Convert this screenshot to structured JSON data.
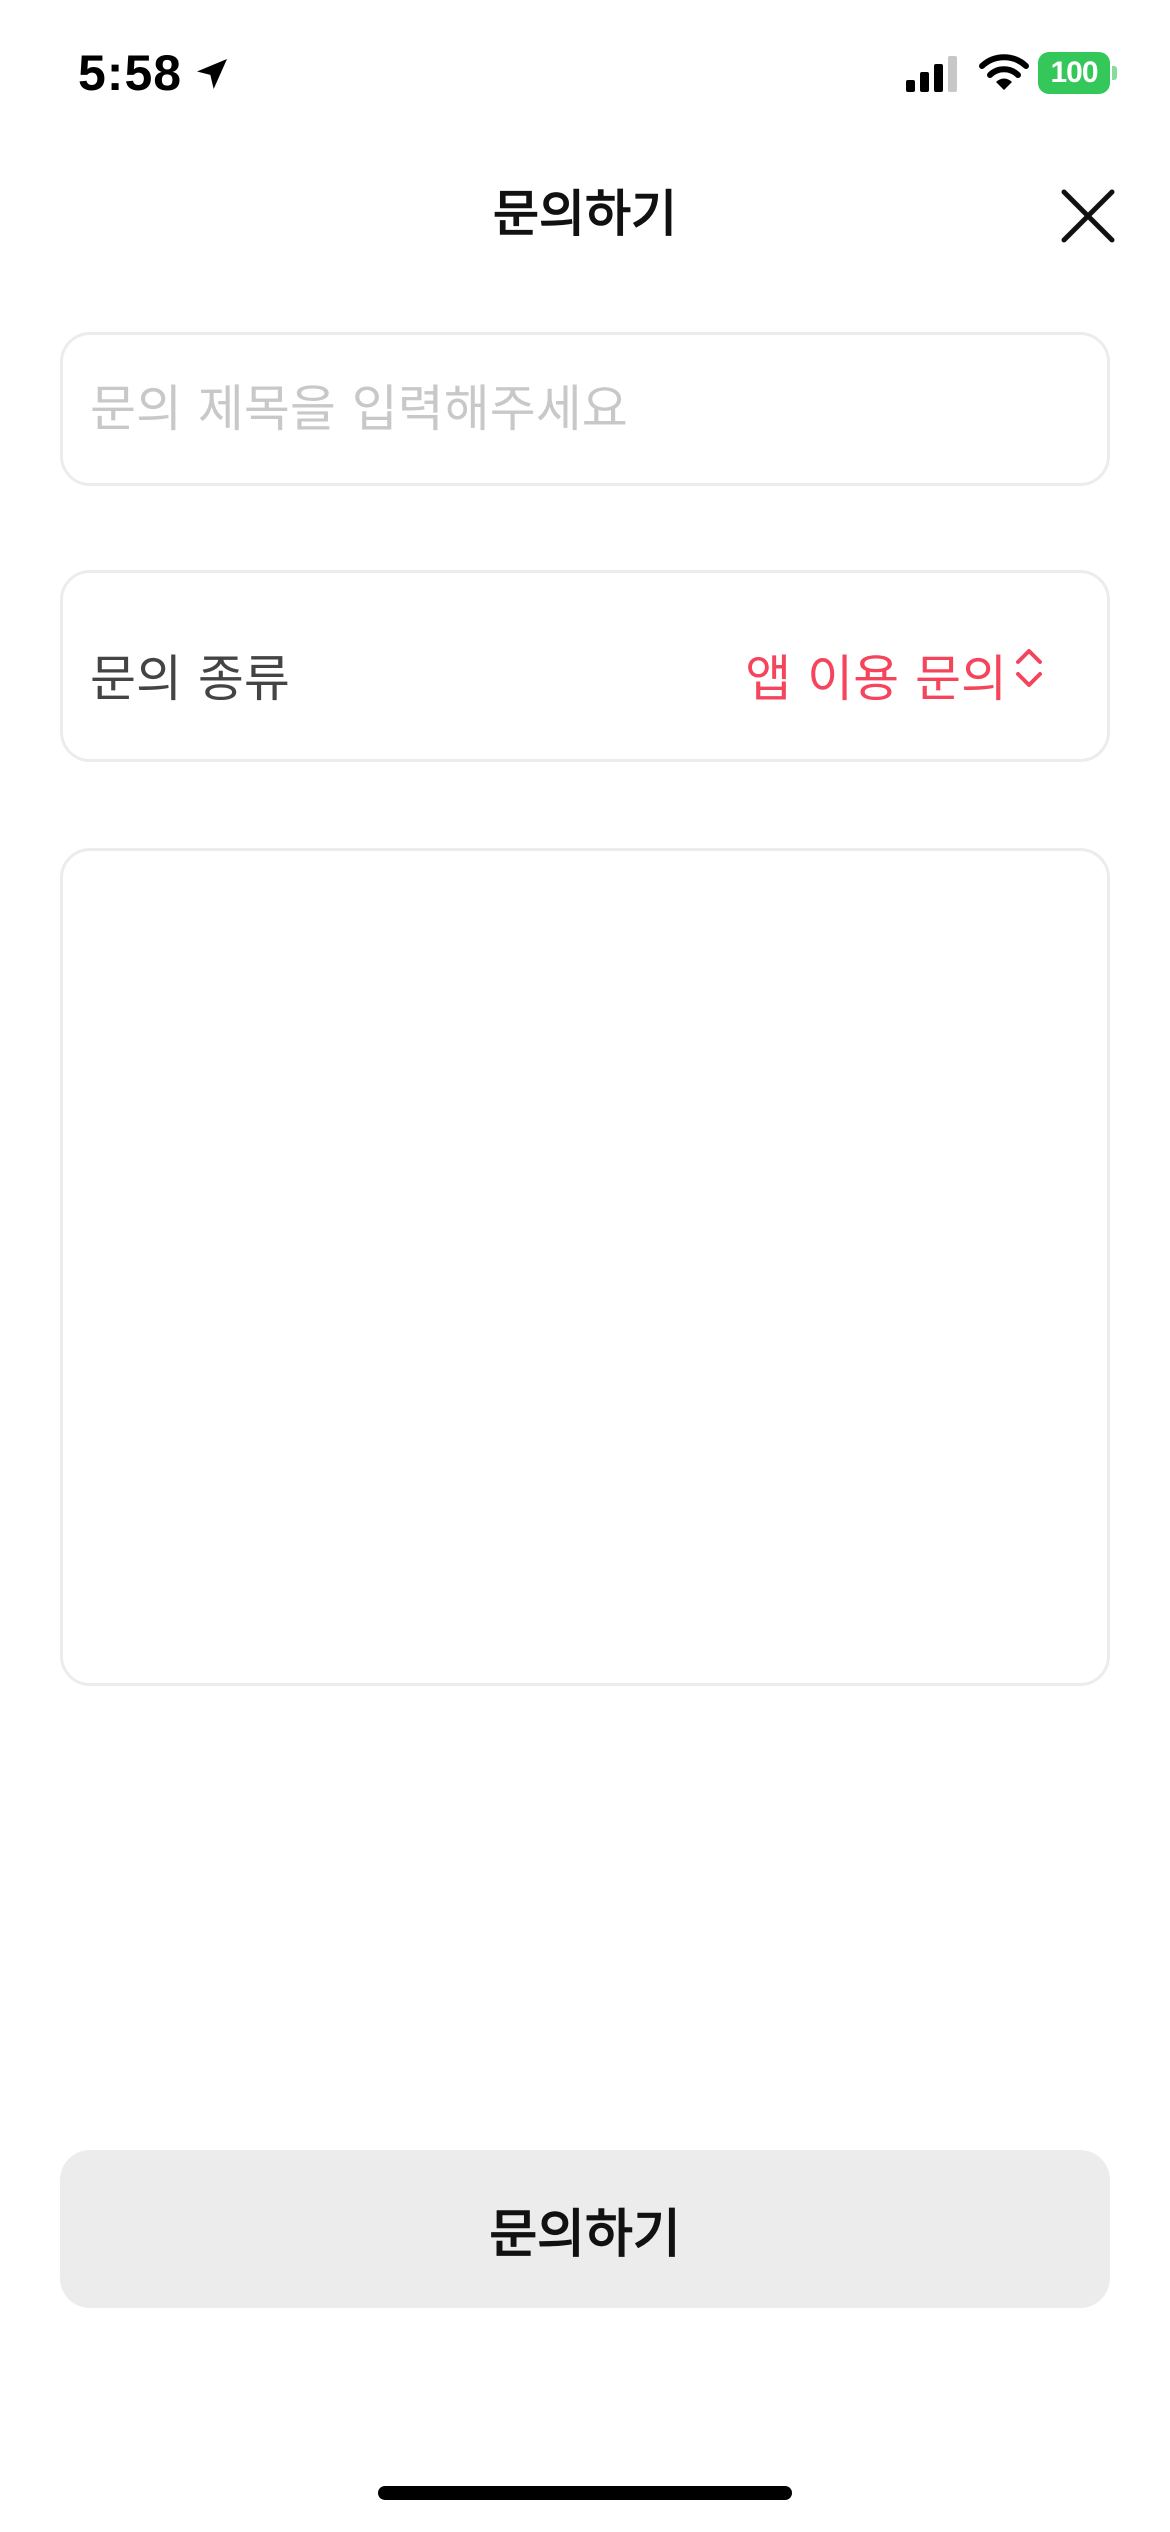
{
  "status_bar": {
    "time": "5:58",
    "battery_level": "100",
    "icons": [
      "location-arrow-icon",
      "cellular-signal-icon",
      "wifi-icon",
      "battery-icon"
    ],
    "battery_color": "#34c759"
  },
  "header": {
    "title": "문의하기",
    "close_icon": "close-icon"
  },
  "form": {
    "title_field": {
      "value": "",
      "placeholder": "문의 제목을 입력해주세요"
    },
    "type_field": {
      "label": "문의 종류",
      "selected_value": "앱 이용 문의",
      "icon": "chevron-up-down-icon",
      "accent_color": "#f5455c"
    },
    "content_field": {
      "value": "",
      "placeholder": ""
    }
  },
  "submit": {
    "label": "문의하기"
  }
}
